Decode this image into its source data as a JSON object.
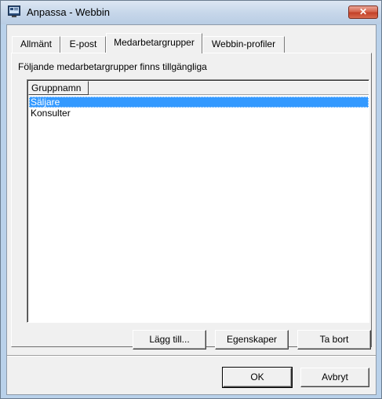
{
  "window": {
    "title": "Anpassa - Webbin",
    "close_label": "✕"
  },
  "tabs": [
    {
      "label": "Allmänt",
      "active": false
    },
    {
      "label": "E-post",
      "active": false
    },
    {
      "label": "Medarbetargrupper",
      "active": true
    },
    {
      "label": "Webbin-profiler",
      "active": false
    }
  ],
  "page": {
    "description": "Följande medarbetargrupper finns tillgängliga",
    "list": {
      "column_header": "Gruppnamn",
      "rows": [
        {
          "label": "Säljare",
          "selected": true
        },
        {
          "label": "Konsulter",
          "selected": false
        }
      ]
    },
    "buttons": {
      "add": "Lägg till...",
      "properties": "Egenskaper",
      "remove": "Ta bort"
    }
  },
  "dialog_buttons": {
    "ok": "OK",
    "cancel": "Avbryt"
  },
  "colors": {
    "selection": "#3399ff",
    "close_button": "#c8442b"
  }
}
